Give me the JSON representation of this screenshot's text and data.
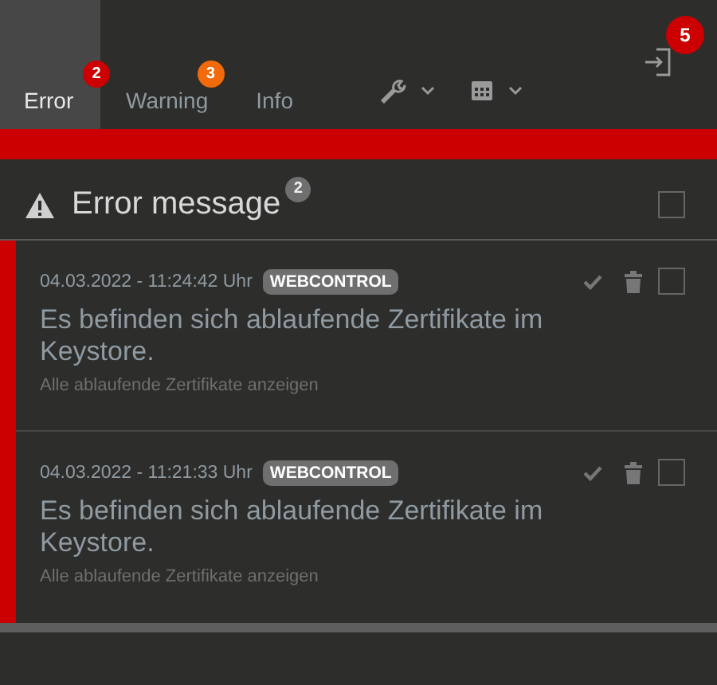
{
  "tabs": [
    {
      "label": "Error",
      "selected": true,
      "badge": "2",
      "color": "#cc0000"
    },
    {
      "label": "Warning",
      "selected": false,
      "badge": "3",
      "color": "#f26a0a"
    },
    {
      "label": "Info",
      "selected": false
    }
  ],
  "logout": {
    "badge": "5"
  },
  "header": {
    "title": "Error message",
    "count": "2",
    "checked": false
  },
  "messages": [
    {
      "timestamp": "04.03.2022 - 11:24:42 Uhr",
      "source": "WEBCONTROL",
      "text": "Es befinden sich ablaufende Zertifikate im Keystore.",
      "link": "Alle ablaufende Zertifikate anzeigen",
      "checked": false
    },
    {
      "timestamp": "04.03.2022 - 11:21:33 Uhr",
      "source": "WEBCONTROL",
      "text": "Es befinden sich ablaufende Zertifikate im Keystore.",
      "link": "Alle ablaufende Zertifikate anzeigen",
      "checked": false
    }
  ]
}
